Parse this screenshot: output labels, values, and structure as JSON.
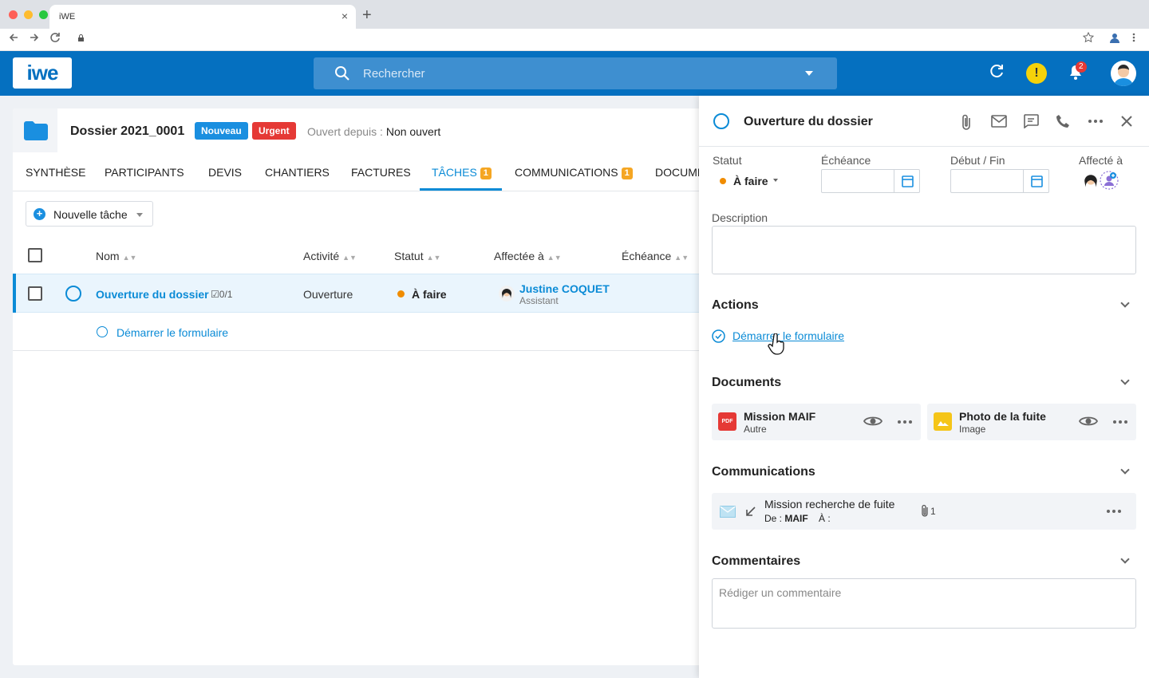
{
  "browser": {
    "tab_title": "iWE",
    "tab_close": "×",
    "new_tab": "+"
  },
  "header": {
    "logo": "iwe",
    "search_placeholder": "Rechercher",
    "notifications_count": "2",
    "warning_symbol": "!"
  },
  "dossier": {
    "title": "Dossier 2021_0001",
    "badges": [
      {
        "label": "Nouveau",
        "color": "#1a8fe0"
      },
      {
        "label": "Urgent",
        "color": "#e53935"
      }
    ],
    "opened_label": "Ouvert depuis : ",
    "opened_value": "Non ouvert"
  },
  "tabs": [
    {
      "label": "Synthèse",
      "active": false
    },
    {
      "label": "Participants",
      "active": false
    },
    {
      "label": "Devis",
      "active": false
    },
    {
      "label": "Chantiers",
      "active": false
    },
    {
      "label": "Factures",
      "active": false
    },
    {
      "label": "Tâches",
      "active": true,
      "badge": "1"
    },
    {
      "label": "Communications",
      "active": false,
      "badge": "1"
    },
    {
      "label": "Docume",
      "active": false
    }
  ],
  "toolbar": {
    "new_task_label": "Nouvelle tâche"
  },
  "table": {
    "columns": [
      "Nom",
      "Activité",
      "Statut",
      "Affectée à",
      "Échéance"
    ],
    "rows": [
      {
        "name": "Ouverture du dossier",
        "subtasks": "0/1",
        "activity": "Ouverture",
        "status": "À faire",
        "assignee_name": "Justine COQUET",
        "assignee_role": "Assistant"
      }
    ],
    "subtask_label": "Démarrer le formulaire"
  },
  "drawer": {
    "title": "Ouverture du dossier",
    "fields": {
      "statut_label": "Statut",
      "statut_value": "À faire",
      "echeance_label": "Échéance",
      "debut_fin_label": "Début / Fin",
      "affecte_label": "Affecté à",
      "description_label": "Description"
    },
    "sections": {
      "actions": "Actions",
      "documents": "Documents",
      "communications": "Communications",
      "comments": "Commentaires"
    },
    "action_link": "Démarrer le formulaire",
    "documents": [
      {
        "title": "Mission MAIF",
        "sub": "Autre",
        "icon_label": "PDF",
        "color": "#e53935"
      },
      {
        "title": "Photo de la fuite",
        "sub": "Image",
        "icon_label": "",
        "color": "#f5c518"
      }
    ],
    "communication": {
      "title": "Mission recherche de fuite",
      "from_label": "De : ",
      "from_value": "MAIF",
      "to_label": "À :",
      "attachments": "1"
    },
    "comment_placeholder": "Rédiger un commentaire"
  },
  "colors": {
    "brand": "#0570c0",
    "accent": "#0b8bd6",
    "status_todo": "#f08c00",
    "tab_badge": "#f5a623"
  }
}
